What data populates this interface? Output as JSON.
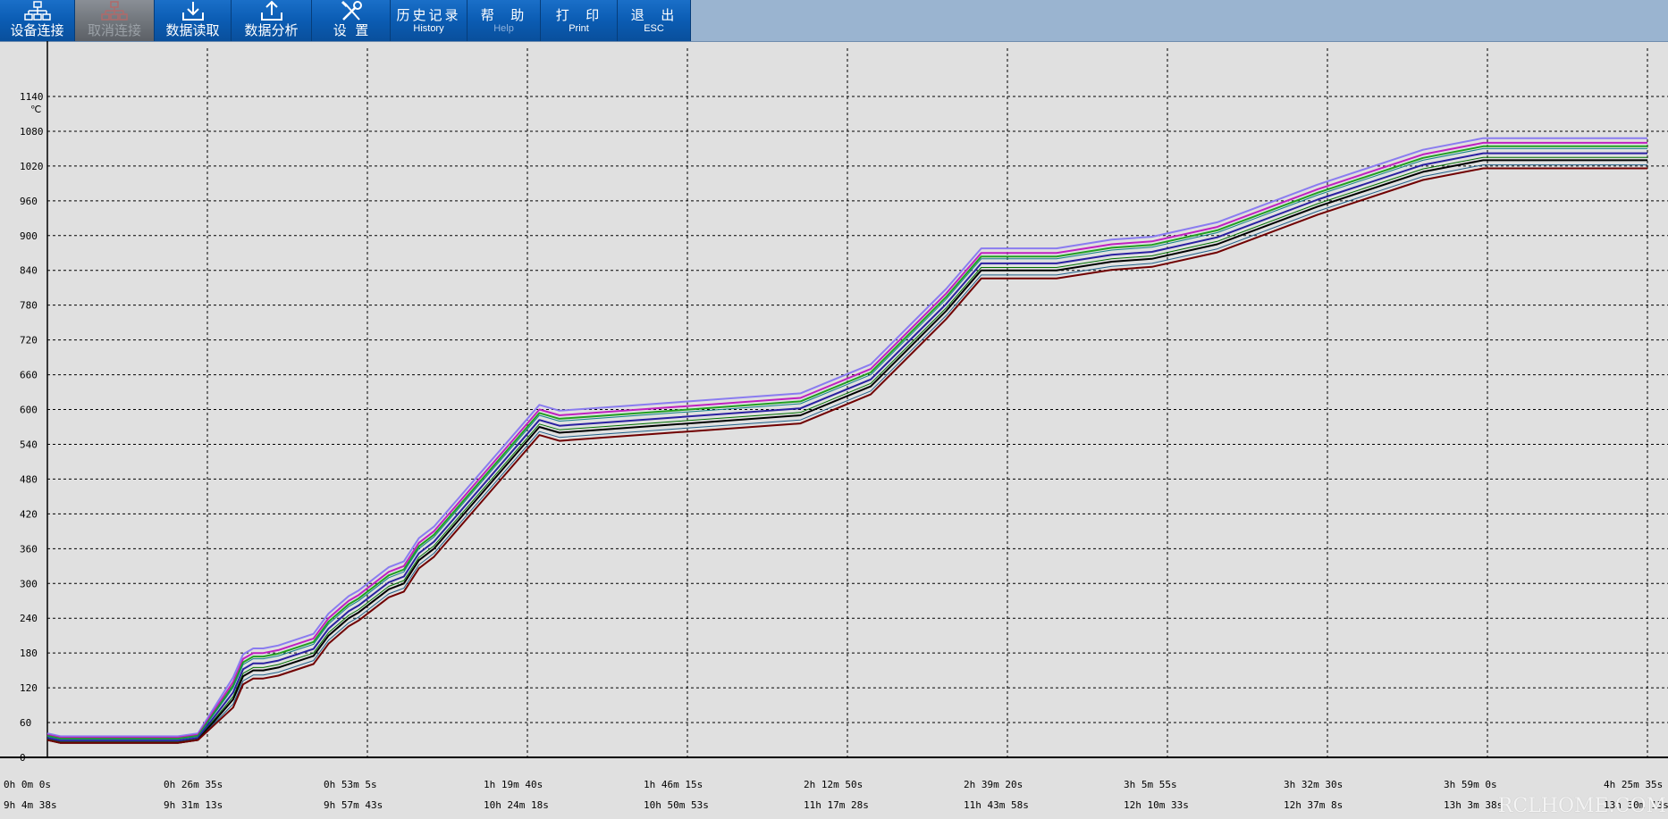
{
  "toolbar": {
    "buttons": [
      {
        "id": "connect",
        "label": "设备连接",
        "icon": "network-icon",
        "disabled": false
      },
      {
        "id": "disconnect",
        "label": "取消连接",
        "icon": "network-icon",
        "disabled": true
      },
      {
        "id": "read",
        "label": "数据读取",
        "icon": "download-icon",
        "disabled": false
      },
      {
        "id": "analysis",
        "label": "数据分析",
        "icon": "upload-icon",
        "disabled": false
      },
      {
        "id": "settings",
        "label": "设  置",
        "icon": "tools-icon",
        "disabled": false
      },
      {
        "id": "history",
        "label": "历史记录",
        "sub": "History"
      },
      {
        "id": "help",
        "label": "帮  助",
        "sub": "Help"
      },
      {
        "id": "print",
        "label": "打  印",
        "sub": "Print"
      },
      {
        "id": "esc",
        "label": "退  出",
        "sub": "ESC"
      }
    ],
    "colors": {
      "button": "#0b5cb3",
      "disabled": "#6f747a",
      "bar": "#9ab4d0"
    }
  },
  "chart_data": {
    "type": "line",
    "yunit": "℃",
    "ylim": [
      0,
      1140
    ],
    "yticks": [
      0,
      60,
      120,
      180,
      240,
      300,
      360,
      420,
      480,
      540,
      600,
      660,
      720,
      780,
      840,
      900,
      960,
      1020,
      1080,
      1140
    ],
    "xlim": [
      0,
      15935
    ],
    "xticks": [
      {
        "elapsed": "0h 0m 0s",
        "clock": "9h 4m 38s"
      },
      {
        "elapsed": "0h 26m 35s",
        "clock": "9h 31m 13s"
      },
      {
        "elapsed": "0h 53m 5s",
        "clock": "9h 57m 43s"
      },
      {
        "elapsed": "1h 19m 40s",
        "clock": "10h 24m 18s"
      },
      {
        "elapsed": "1h 46m 15s",
        "clock": "10h 50m 53s"
      },
      {
        "elapsed": "2h 12m 50s",
        "clock": "11h 17m 28s"
      },
      {
        "elapsed": "2h 39m 20s",
        "clock": "11h 43m 58s"
      },
      {
        "elapsed": "3h 5m 55s",
        "clock": "12h 10m 33s"
      },
      {
        "elapsed": "3h 32m 30s",
        "clock": "12h 37m 8s"
      },
      {
        "elapsed": "3h 59m 0s",
        "clock": "13h 3m 38s"
      },
      {
        "elapsed": "4h 25m 35s",
        "clock": "13h 30m 13s"
      }
    ],
    "grid": true,
    "base_x": [
      0,
      130,
      300,
      420,
      650,
      900,
      1080,
      1150,
      1300,
      1500,
      1850,
      1950,
      2050,
      2150,
      2300,
      2650,
      2800,
      3000,
      3100,
      3400,
      3550,
      3700,
      3850,
      4000,
      4300,
      4550,
      4900,
      5100,
      5500,
      6300,
      7500,
      8200,
      8950,
      9300,
      10050,
      10600,
      11000,
      11650,
      12650,
      13700,
      14300,
      14550,
      15000,
      15935
    ],
    "base_y": [
      30,
      25,
      25,
      25,
      25,
      25,
      25,
      25,
      25,
      30,
      100,
      140,
      150,
      150,
      155,
      175,
      210,
      240,
      250,
      290,
      300,
      340,
      360,
      390,
      450,
      500,
      570,
      560,
      565,
      575,
      590,
      640,
      770,
      840,
      840,
      855,
      860,
      885,
      950,
      1010,
      1030,
      1030,
      1030,
      1030
    ],
    "series": [
      {
        "color": "#8a7cf0",
        "offset": 38,
        "step": 2
      },
      {
        "color": "#c020c0",
        "offset": 30,
        "step": 2
      },
      {
        "color": "#20a020",
        "offset": 24,
        "step": 2
      },
      {
        "color": "#10808a",
        "offset": 20,
        "step": 1
      },
      {
        "color": "#2a20a0",
        "offset": 12,
        "step": 2
      },
      {
        "color": "#007000",
        "offset": 5,
        "step": 1
      },
      {
        "color": "#000000",
        "offset": 0,
        "step": 2
      },
      {
        "color": "#20608a",
        "offset": -8,
        "step": 1
      },
      {
        "color": "#700000",
        "offset": -14,
        "step": 2
      }
    ]
  },
  "watermark": "RCLHOME.COM"
}
